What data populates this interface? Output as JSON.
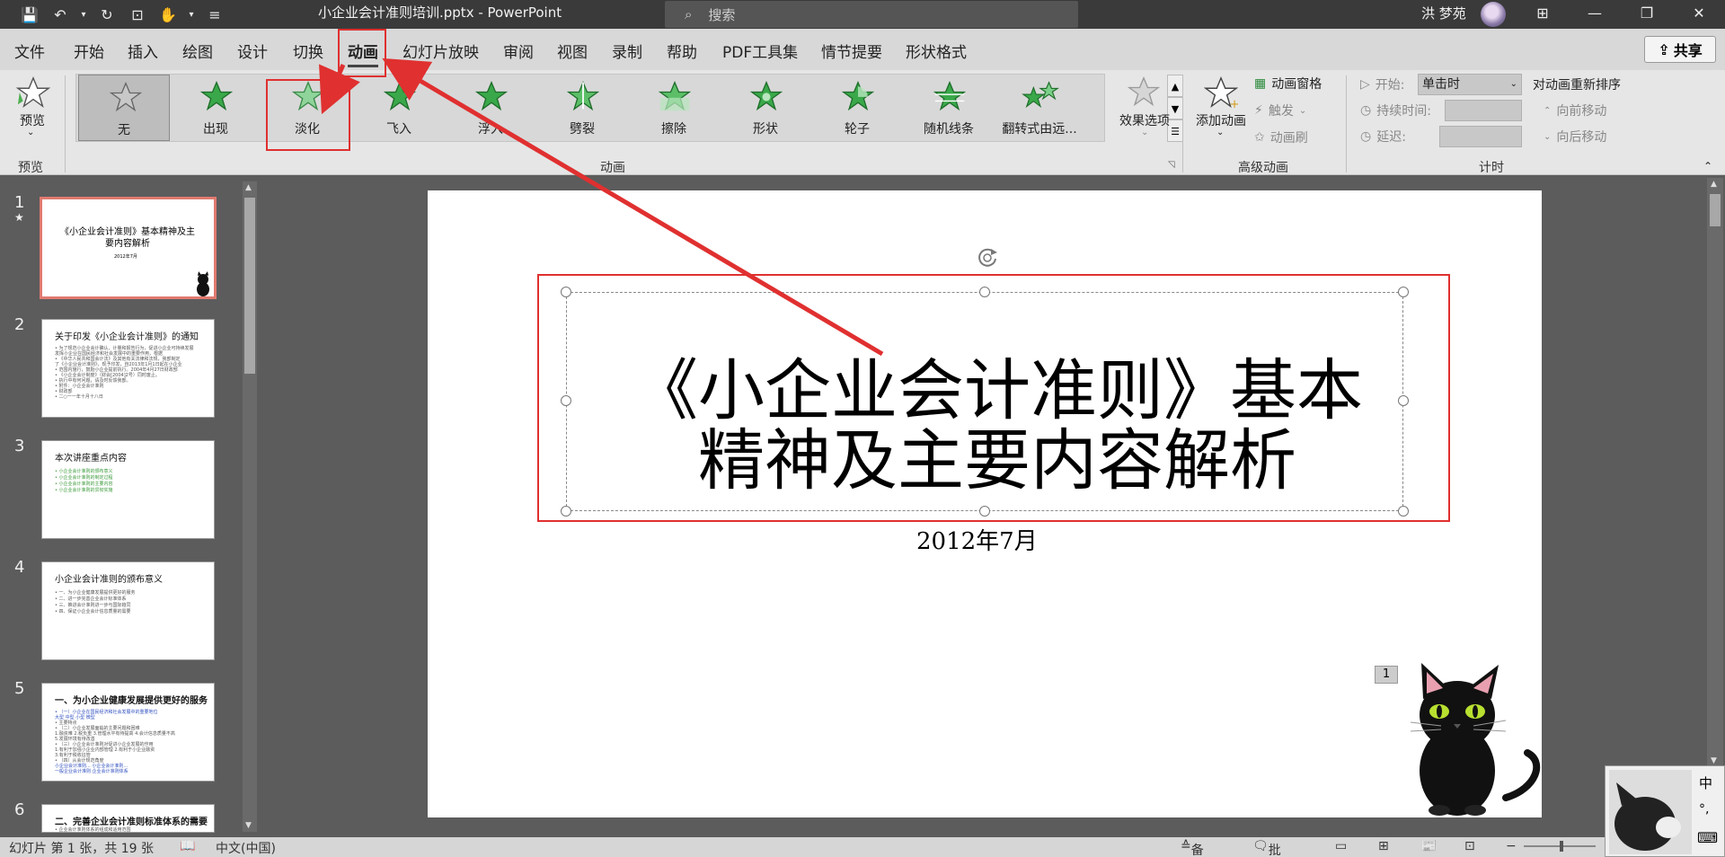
{
  "titlebar": {
    "quick_access": [
      "💾",
      "↶",
      "▾",
      "↻",
      "⊡",
      "✋",
      "▾",
      "≡"
    ],
    "doc_title": "小企业会计准则培训.pptx  -  PowerPoint",
    "search_placeholder": "搜索",
    "user_name": "洪 梦苑",
    "window_controls": [
      "⊞",
      "—",
      "❐",
      "✕"
    ]
  },
  "menu": {
    "tabs": [
      "文件",
      "开始",
      "插入",
      "绘图",
      "设计",
      "切换",
      "动画",
      "幻灯片放映",
      "审阅",
      "视图",
      "录制",
      "帮助",
      "PDF工具集",
      "情节提要",
      "形状格式"
    ],
    "active_tab": "动画",
    "share": "共享"
  },
  "ribbon": {
    "preview_label": "预览",
    "preview_group": "预览",
    "gallery_items": [
      "无",
      "出现",
      "淡化",
      "飞入",
      "浮入",
      "劈裂",
      "擦除",
      "形状",
      "轮子",
      "随机线条",
      "翻转式由远..."
    ],
    "effect_options": "效果选项",
    "animation_group": "动画",
    "add_animation": "添加动画",
    "animation_pane": "动画窗格",
    "trigger": "触发",
    "animation_painter": "动画刷",
    "advanced_group": "高级动画",
    "start_label": "开始:",
    "start_value": "单击时",
    "duration_label": "持续时间:",
    "delay_label": "延迟:",
    "timing_group": "计时",
    "reorder_title": "对动画重新排序",
    "move_earlier": "向前移动",
    "move_later": "向后移动"
  },
  "thumbnails": [
    {
      "num": "1",
      "title": "《小企业会计准则》基本精神及主要内容解析",
      "sub": "2012年7月"
    },
    {
      "num": "2",
      "title": "关于印发《小企业会计准则》的通知",
      "lines": [
        "• 为了规范小企业会计确认、计量和报告行为，促进小企业可持续发展",
        "  发挥小企业在国民经济和社会发展中的重要作用，根据",
        "• 《中华人民共和国会计法》及其他有关法律和法规，我部制定",
        "  了《小企业会计准则》，现予印发，自2013年1月1日起在小企业",
        "• 范围内施行，鼓励小企业提前执行。2004年4月27日财政部",
        "• 《小企业会计制度》（财会[2004]2号）同时废止。",
        "• 执行中有何问题，请及时反馈我部。",
        "• 附件：小企业会计准则",
        "• 财政部",
        "• 二○一一年十月十八日"
      ]
    },
    {
      "num": "3",
      "title": "本次讲座重点内容",
      "lines": [
        "• 小企业会计准则的颁布意义",
        "• 小企业会计准则的制定过程",
        "• 小企业会计准则的主要内容",
        "• 小企业会计准则的贯彻实施"
      ]
    },
    {
      "num": "4",
      "title": "小企业会计准则的颁布意义",
      "lines": [
        "• 一、为小企业健康发展提供更好的服务",
        "• 二、进一步完善企业会计标准体系",
        "• 三、推进会计准则进一步与国际趋同",
        "• 四、保证小企业会计信息质量的需要"
      ]
    },
    {
      "num": "5",
      "title": "一、为小企业健康发展提供更好的服务",
      "lines": [
        "• （一）小企业在国民经济和社会发展中的重要地位",
        "    大型        中型        小型        微型",
        "• 主要特点",
        "• （二）小企业发展面临的主要问题和困难",
        "    1.融资难 2.税负重 3.管理水平有待提高 4.会计信息质量不高",
        "    5.发展环境有待改善",
        "• （三）小企业会计准则对促进小企业发展的作用",
        "    1.有利于加强小企业内部管理 2.有利于小企业融资",
        "    3.有利于税收征管",
        "• （四）从会计规范角度",
        "    小企业会计准则...   小企业会计准则...",
        "    一般企业会计准则   企业会计准则体系"
      ]
    },
    {
      "num": "6",
      "title": "二、完善企业会计准则标准体系的需要",
      "lines": [
        "• 企业会计准则体系的组成和适用范围"
      ]
    }
  ],
  "slide": {
    "title_line1": "《小企业会计准则》基本",
    "title_line2": "精神及主要内容解析",
    "subtitle": "2012年7月",
    "page_number": "1"
  },
  "status": {
    "slide_info": "幻灯片 第 1 张，共 19 张",
    "language": "中文(中国)",
    "notes": "备注",
    "comments": "批注"
  },
  "ime": {
    "items": [
      "中",
      "°,",
      "⌨"
    ]
  },
  "colors": {
    "annotation_red": "#e03030",
    "star_green": "#4caf50",
    "selected_thumb_border": "#e07a70"
  }
}
